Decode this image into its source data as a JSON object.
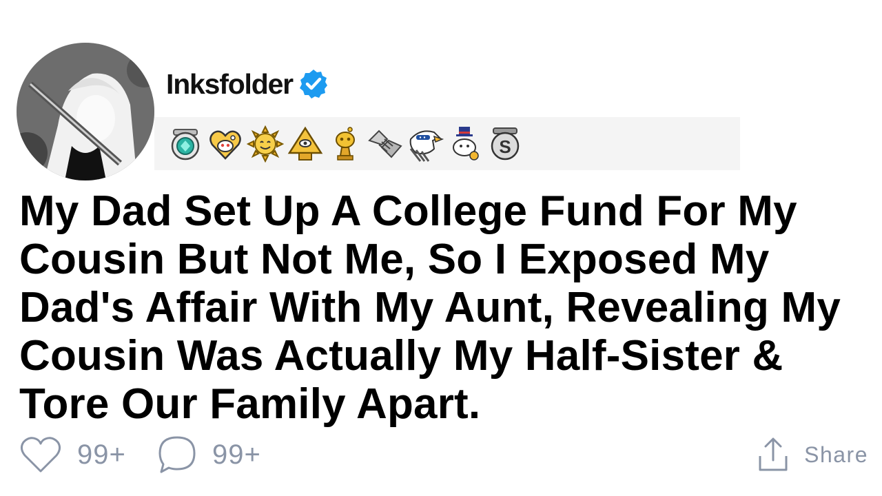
{
  "post": {
    "author": {
      "username": "Inksfolder",
      "verified": true,
      "avatar_icon": "anime-character-avatar"
    },
    "awards": [
      {
        "icon": "teal-gem-award-icon"
      },
      {
        "icon": "heart-snoo-award-icon"
      },
      {
        "icon": "sun-face-award-icon"
      },
      {
        "icon": "pyramid-eye-award-icon"
      },
      {
        "icon": "gold-trophy-snoo-award-icon"
      },
      {
        "icon": "handshake-award-icon"
      },
      {
        "icon": "eagle-award-icon"
      },
      {
        "icon": "top-hat-snoo-award-icon"
      },
      {
        "icon": "silver-s-award-icon"
      }
    ],
    "title": "My Dad Set Up A College Fund For My Cousin But Not Me, So I Exposed My Dad's Affair With My Aunt, Revealing My Cousin Was Actually My Half-Sister & Tore Our Family Apart.",
    "stats": {
      "likes": "99+",
      "comments": "99+"
    },
    "share_label": "Share"
  },
  "colors": {
    "verified_blue": "#1d9bf0",
    "meta_gray": "#8a94a6",
    "awards_bg": "#f4f4f4"
  }
}
